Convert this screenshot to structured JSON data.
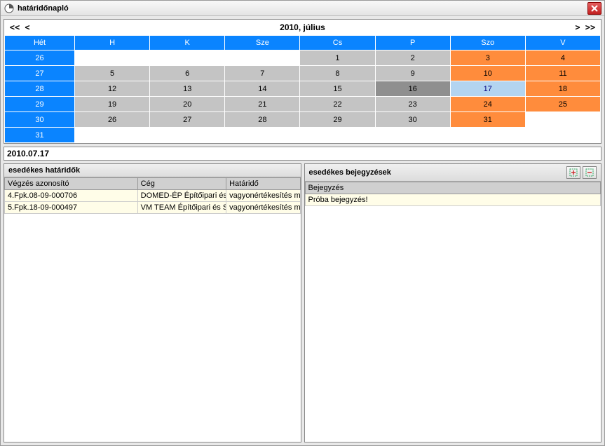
{
  "window": {
    "title": "határidőnapló"
  },
  "calendar": {
    "title": "2010, július",
    "week_label": "Hét",
    "days": [
      "H",
      "K",
      "Sze",
      "Cs",
      "P",
      "Szo",
      "V"
    ],
    "weeks": [
      {
        "num": "26",
        "cells": [
          {
            "v": "",
            "c": "empty"
          },
          {
            "v": "",
            "c": "empty"
          },
          {
            "v": "",
            "c": "empty"
          },
          {
            "v": "1",
            "c": "normal"
          },
          {
            "v": "2",
            "c": "normal"
          },
          {
            "v": "3",
            "c": "wknd"
          },
          {
            "v": "4",
            "c": "wknd"
          }
        ]
      },
      {
        "num": "27",
        "cells": [
          {
            "v": "5",
            "c": "normal"
          },
          {
            "v": "6",
            "c": "normal"
          },
          {
            "v": "7",
            "c": "normal"
          },
          {
            "v": "8",
            "c": "normal"
          },
          {
            "v": "9",
            "c": "normal"
          },
          {
            "v": "10",
            "c": "wknd"
          },
          {
            "v": "11",
            "c": "wknd"
          }
        ]
      },
      {
        "num": "28",
        "cells": [
          {
            "v": "12",
            "c": "normal"
          },
          {
            "v": "13",
            "c": "normal"
          },
          {
            "v": "14",
            "c": "normal"
          },
          {
            "v": "15",
            "c": "normal"
          },
          {
            "v": "16",
            "c": "today"
          },
          {
            "v": "17",
            "c": "selected"
          },
          {
            "v": "18",
            "c": "wknd"
          }
        ]
      },
      {
        "num": "29",
        "cells": [
          {
            "v": "19",
            "c": "normal"
          },
          {
            "v": "20",
            "c": "normal"
          },
          {
            "v": "21",
            "c": "normal"
          },
          {
            "v": "22",
            "c": "normal"
          },
          {
            "v": "23",
            "c": "normal"
          },
          {
            "v": "24",
            "c": "wknd"
          },
          {
            "v": "25",
            "c": "wknd"
          }
        ]
      },
      {
        "num": "30",
        "cells": [
          {
            "v": "26",
            "c": "normal"
          },
          {
            "v": "27",
            "c": "normal"
          },
          {
            "v": "28",
            "c": "normal"
          },
          {
            "v": "29",
            "c": "normal"
          },
          {
            "v": "30",
            "c": "normal"
          },
          {
            "v": "31",
            "c": "wknd"
          },
          {
            "v": "",
            "c": "empty"
          }
        ]
      },
      {
        "num": "31",
        "cells": [
          {
            "v": "",
            "c": "empty"
          },
          {
            "v": "",
            "c": "empty"
          },
          {
            "v": "",
            "c": "empty"
          },
          {
            "v": "",
            "c": "empty"
          },
          {
            "v": "",
            "c": "empty"
          },
          {
            "v": "",
            "c": "empty"
          },
          {
            "v": "",
            "c": "empty"
          }
        ]
      }
    ],
    "selected_date": "2010.07.17"
  },
  "deadlines": {
    "title": "esedékes határidők",
    "columns": [
      "Végzés azonosító",
      "Cég",
      "Határidő"
    ],
    "rows": [
      [
        "4.Fpk.08-09-000706",
        "DOMED-ÉP Építőipari és Szolg.",
        "vagyonértékesítés m"
      ],
      [
        "5.Fpk.18-09-000497",
        "VM TEAM Építőipari és Szolgált",
        "vagyonértékesítés m"
      ]
    ]
  },
  "entries": {
    "title": "esedékes bejegyzések",
    "columns": [
      "Bejegyzés"
    ],
    "rows": [
      [
        "Próba bejegyzés!"
      ]
    ]
  },
  "nav": {
    "prev_year": "<<",
    "prev_month": "<",
    "next_month": ">",
    "next_year": ">>"
  }
}
